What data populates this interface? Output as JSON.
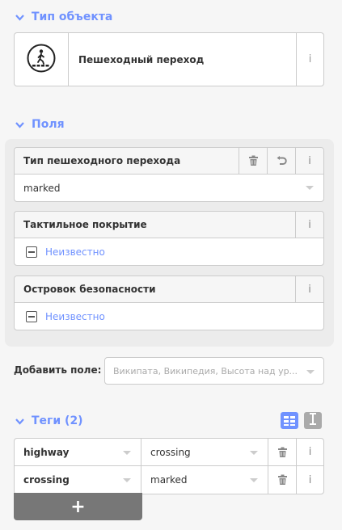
{
  "preset_section": {
    "title": "Тип объекта",
    "preset_name": "Пешеходный переход",
    "preset_icon": "pedestrian-crossing-icon"
  },
  "fields_section": {
    "title": "Поля",
    "fields": [
      {
        "label": "Тип пешеходного перехода",
        "value": "marked"
      },
      {
        "label": "Тактильное покрытие",
        "value": "Неизвестно"
      },
      {
        "label": "Островок безопасности",
        "value": "Неизвестно"
      }
    ],
    "add_field": {
      "label": "Добавить поле:",
      "placeholder": "Википата, Википедия, Высота над ур..."
    }
  },
  "tags_section": {
    "title": "Теги (2)",
    "rows": [
      {
        "key": "highway",
        "value": "crossing"
      },
      {
        "key": "crossing",
        "value": "marked"
      }
    ],
    "add_button": "+"
  },
  "info_glyph": "i",
  "colors": {
    "accent": "#7092ff",
    "border": "#cccccc",
    "panel": "#ececec"
  }
}
